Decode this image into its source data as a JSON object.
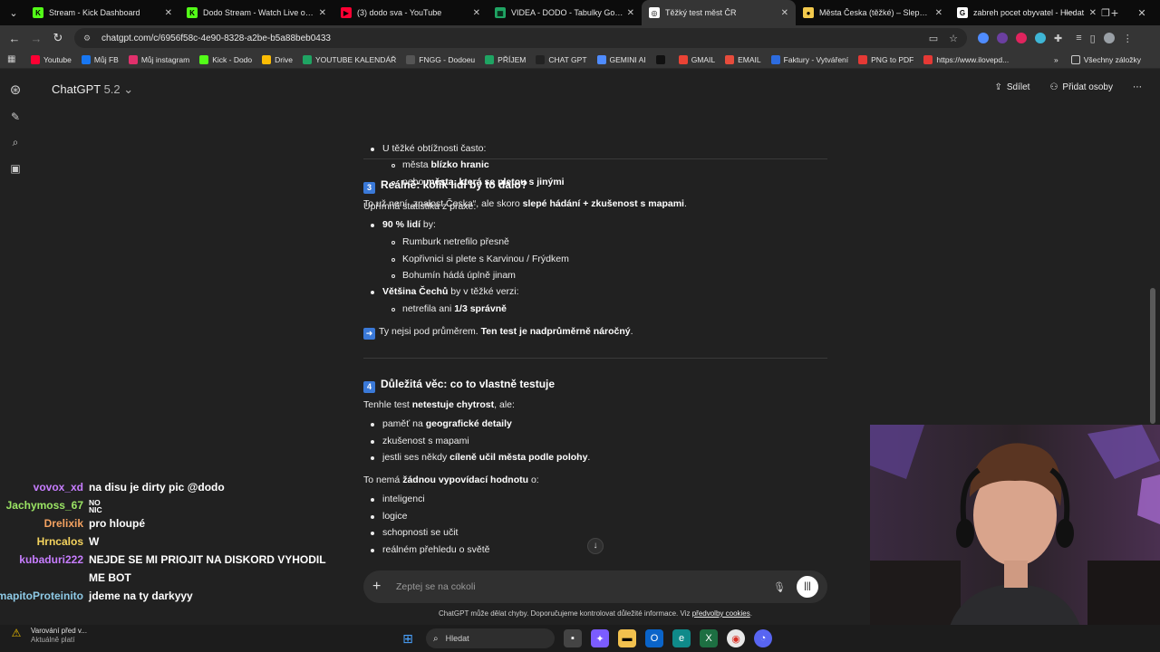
{
  "browser": {
    "tabs": [
      {
        "title": "Stream - Kick Dashboard",
        "fav": "K",
        "color": "#53fc18"
      },
      {
        "title": "Dodo Stream - Watch Live on Kick",
        "fav": "K",
        "color": "#53fc18"
      },
      {
        "title": "(3) dodo sva - YouTube",
        "fav": "▶",
        "color": "#ff0033"
      },
      {
        "title": "VIDEA - DODO - Tabulky Google",
        "fav": "▦",
        "color": "#1fa463"
      },
      {
        "title": "Těžký test měst ČR",
        "fav": "◎",
        "color": "#ffffff"
      },
      {
        "title": "Města Česka (těžké) – Slepé mapy",
        "fav": "●",
        "color": "#f2c94c"
      },
      {
        "title": "zabreh pocet obyvatel - Hledat",
        "fav": "G",
        "color": "#ffffff"
      }
    ],
    "active_tab_index": 4,
    "url": "chatgpt.com/c/6956f58c-4e90-8328-a2be-b5a88beb0433",
    "bookmarks": [
      {
        "label": "Youtube",
        "color": "#ff0033"
      },
      {
        "label": "Můj FB",
        "color": "#1877f2"
      },
      {
        "label": "Můj instagram",
        "color": "#e1306c"
      },
      {
        "label": "Kick - Dodo",
        "color": "#53fc18"
      },
      {
        "label": "Drive",
        "color": "#fbbc04"
      },
      {
        "label": "YOUTUBE KALENDÁŘ",
        "color": "#1fa463"
      },
      {
        "label": "FNGG - Dodoeu",
        "color": "#555555"
      },
      {
        "label": "PŘÍJEM",
        "color": "#1fa463"
      },
      {
        "label": "CHAT GPT",
        "color": "#222222"
      },
      {
        "label": "GEMINI AI",
        "color": "#4f8cff"
      },
      {
        "label": "",
        "color": "#111111"
      },
      {
        "label": "GMAIL",
        "color": "#ea4335"
      },
      {
        "label": "EMAIL",
        "color": "#e74c3c"
      },
      {
        "label": "Faktury - Vytváření",
        "color": "#2d6cdf"
      },
      {
        "label": "PNG to PDF",
        "color": "#e53935"
      },
      {
        "label": "https://www.ilovepd...",
        "color": "#e53935"
      }
    ],
    "all_bookmarks": "Všechny záložky"
  },
  "chatgpt": {
    "model": "ChatGPT",
    "version": "5.2",
    "share": "Sdílet",
    "add_people": "Přidat osoby",
    "intro_line": "U těžké obtížnosti často:",
    "intro_b1_pre": "města ",
    "intro_b1_bold": "blízko hranic",
    "intro_b2_pre": "nebo ",
    "intro_b2_bold": "města, která se pletou s jinými",
    "summary_pre": "To už není „znalost Česka“, ale skoro ",
    "summary_bold": "slepé hádání + zkušenost s mapami",
    "summary_post": ".",
    "sec3_num": "3",
    "sec3_title": "Reálně: kolik lidí by to dalo?",
    "sec3_intro": "Upřímná statistika z praxe:",
    "sec3_b1_bold": "90 % lidí",
    "sec3_b1_post": " by:",
    "sec3_b1_sub": [
      "Rumburk netrefilo přesně",
      "Kopřivnici si plete s Karvinou / Frýdkem",
      "Bohumín hádá úplně jinam"
    ],
    "sec3_b2_bold": "Většina Čechů",
    "sec3_b2_post": " by v těžké verzi:",
    "sec3_b2_sub_pre": "netrefila ani ",
    "sec3_b2_sub_bold": "1/3 správně",
    "sec3_concl_pre": "Ty nejsi pod průměrem. ",
    "sec3_concl_bold": "Ten test je nadprůměrně náročný",
    "sec3_concl_post": ".",
    "sec4_num": "4",
    "sec4_title": "Důležitá věc: co to vlastně testuje",
    "sec4_intro_pre": "Tenhle test ",
    "sec4_intro_bold": "netestuje chytrost",
    "sec4_intro_post": ", ale:",
    "sec4_b1_pre": "paměť na ",
    "sec4_b1_bold": "geografické detaily",
    "sec4_b2": "zkušenost s mapami",
    "sec4_b3_pre": "jestli ses někdy ",
    "sec4_b3_bold": "cíleně učil města podle polohy",
    "sec4_b3_post": ".",
    "sec4_nohod_pre": "To nemá ",
    "sec4_nohod_bold": "žádnou vypovídací hodnotu",
    "sec4_nohod_post": " o:",
    "sec4_list": [
      "inteligenci",
      "logice",
      "schopnosti se učit",
      "reálném přehledu o světě"
    ],
    "composer_placeholder": "Zeptej se na cokoli",
    "disclaimer_pre": "ChatGPT může dělat chyby. Doporučujeme kontrolovat důležité informace. Viz ",
    "disclaimer_link": "předvolby cookies",
    "disclaimer_post": "."
  },
  "stream_chat": [
    {
      "user": "vovox_xd",
      "color": "#c77dff",
      "msg": "na disu je dirty pic @dodo"
    },
    {
      "user": "Jachymoss_67",
      "color": "#9be564",
      "msg": "NO NIC",
      "small": true
    },
    {
      "user": "Drelixik",
      "color": "#f4a261",
      "msg": "pro hloupé"
    },
    {
      "user": "Hrncalos",
      "color": "#f4d35e",
      "msg": "W"
    },
    {
      "user": "kubaduri222",
      "color": "#c77dff",
      "msg": "NEJDE SE MI PRIOJIT NA DISKORD VYHODIL"
    },
    {
      "user": "",
      "color": "#ffffff",
      "msg": "ME BOT"
    },
    {
      "user": "mapitoProteinito",
      "color": "#8ecae6",
      "msg": "jdeme na ty darkyyy"
    }
  ],
  "taskbar": {
    "warning_title": "Varování před v...",
    "warning_sub": "Aktuálně platí",
    "search_placeholder": "Hledat"
  }
}
